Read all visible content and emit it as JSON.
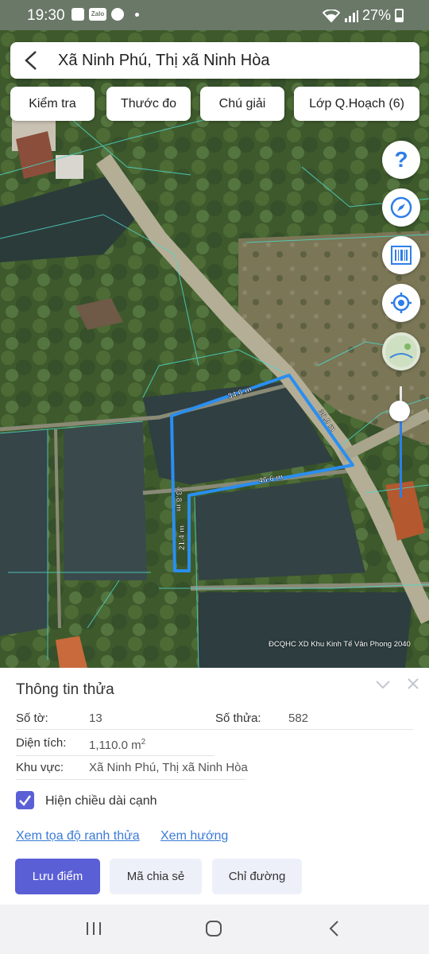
{
  "status_bar": {
    "time": "19:30",
    "app_icons": [
      "gallery-icon",
      "zalo-icon",
      "facebook-icon",
      "dot-icon"
    ],
    "battery": "27%"
  },
  "header": {
    "title": "Xã Ninh Phú, Thị xã Ninh Hòa"
  },
  "toolbar": {
    "chips": [
      "Kiểm tra",
      "Thước đo",
      "Chú giải",
      "Lớp Q.Hoạch (6)"
    ]
  },
  "map": {
    "edge_labels": [
      "34.6 m",
      "30.9 m",
      "46.6 m",
      "43.8 m",
      "21.4 m"
    ],
    "parcel_color": "#2a8ef0",
    "attribution": "ĐCQHC XD Khu Kinh Tế Vân Phong 2040",
    "side_buttons": [
      "help-icon",
      "compass-icon",
      "barcode-icon",
      "my-location-icon",
      "map-layer-icon"
    ]
  },
  "panel": {
    "title": "Thông tin thửa",
    "so_to_label": "Số tờ:",
    "so_to_value": "13",
    "so_thua_label": "Số thửa:",
    "so_thua_value": "582",
    "dien_tich_label": "Diện tích:",
    "dien_tich_value": "1,110.0 m",
    "dien_tich_unit_sup": "2",
    "khu_vuc_label": "Khu vực:",
    "khu_vuc_value": "Xã Ninh Phú, Thị xã Ninh Hòa",
    "checkbox_label": "Hiện chiều dài cạnh",
    "checkbox_checked": true,
    "link_coords": "Xem tọa độ ranh thửa",
    "link_direction": "Xem hướng",
    "buttons": [
      "Lưu điểm",
      "Mã chia sẻ",
      "Chỉ đường"
    ],
    "accent": "#5b5fd6"
  }
}
